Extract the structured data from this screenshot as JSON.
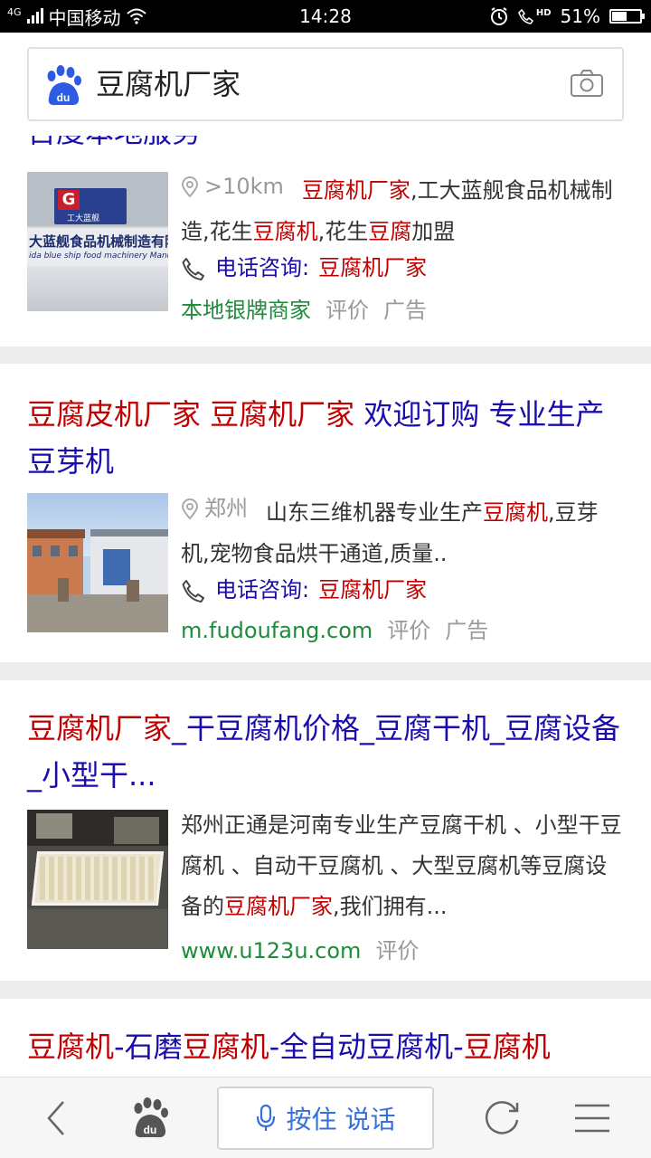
{
  "status_bar": {
    "network": "4G",
    "carrier": "中国移动",
    "time": "14:28",
    "hd_label": "HD",
    "battery": "51%",
    "battery_level": 0.51
  },
  "search": {
    "query": "豆腐机厂家",
    "logo_text": "du"
  },
  "results": [
    {
      "title_partial": "百度本地服务",
      "thumb_sign_top": "工大蓝舰",
      "thumb_sign_cn": "大蓝舰食品机械制造有限",
      "thumb_sign_en": "ida blue ship food machinery Manufacturi",
      "location": ">10km",
      "desc_hl1": "豆腐机厂家",
      "desc_t1": ",工大蓝舰食品机械制造,花生",
      "desc_hl2": "豆腐机",
      "desc_t2": ",花生",
      "desc_hl3": "豆腐",
      "desc_t3": "加盟",
      "phone_label": "电话咨询:",
      "phone_value": "豆腐机厂家",
      "source": "本地银牌商家",
      "review": "评价",
      "ad": "广告"
    },
    {
      "title_p1": "豆腐皮机厂家 豆腐机厂家",
      "title_p2": " 欢迎订购 专业生产豆芽机",
      "location": "郑州",
      "desc_t1": "山东三维机器专业生产",
      "desc_hl1": "豆腐机",
      "desc_t2": ",豆芽机,宠物食品烘干通道,质量..",
      "phone_label": "电话咨询:",
      "phone_value": "豆腐机厂家",
      "source": "m.fudoufang.com",
      "review": "评价",
      "ad": "广告"
    },
    {
      "title_p1": "豆腐机厂家",
      "title_p2": "_干豆腐机价格_豆腐干机_豆腐设备_小型干...",
      "desc_t1": "郑州正通是河南专业生产豆腐干机 、小型干豆腐机 、自动干豆腐机 、大型豆腐机等豆腐设备的",
      "desc_hl1": "豆腐机厂家",
      "desc_t2": ",我们拥有...",
      "source": "www.u123u.com",
      "review": "评价"
    },
    {
      "title_hl1": "豆腐机",
      "title_t1": "-石磨",
      "title_hl2": "豆腐机",
      "title_t2": "-全自动豆腐机-",
      "title_hl3": "豆腐机"
    }
  ],
  "bottom_bar": {
    "voice_label": "按住 说话",
    "home_logo_text": "du"
  },
  "colors": {
    "link_blue": "#1a0dab",
    "highlight_red": "#c00000",
    "source_green": "#1e8c3a",
    "voice_blue": "#3570d8"
  }
}
